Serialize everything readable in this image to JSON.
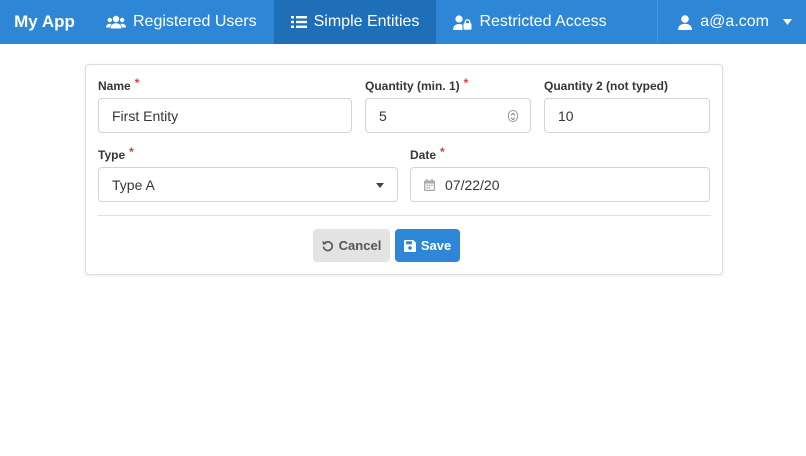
{
  "navbar": {
    "brand": "My App",
    "items": [
      {
        "label": "Registered Users",
        "icon": "users-icon",
        "active": false
      },
      {
        "label": "Simple Entities",
        "icon": "list-icon",
        "active": true
      },
      {
        "label": "Restricted Access",
        "icon": "user-lock-icon",
        "active": false
      }
    ],
    "user": {
      "label": "a@a.com",
      "icon": "user-icon"
    }
  },
  "form": {
    "name": {
      "label": "Name",
      "required_marker": "*",
      "value": "First Entity"
    },
    "quantity": {
      "label": "Quantity (min. 1)",
      "required_marker": "*",
      "value": "5"
    },
    "quantity2": {
      "label": "Quantity 2 (not typed)",
      "value": "10"
    },
    "type": {
      "label": "Type",
      "required_marker": "*",
      "value": "Type A"
    },
    "date": {
      "label": "Date",
      "required_marker": "*",
      "value": "07/22/20"
    }
  },
  "actions": {
    "cancel_label": "Cancel",
    "save_label": "Save"
  },
  "colors": {
    "navbar": "#2e86d6",
    "navbar_active": "#1f6fb8",
    "required": "#e03a3a",
    "primary_button": "#2e86d6",
    "cancel_button": "#e3e3e3"
  }
}
